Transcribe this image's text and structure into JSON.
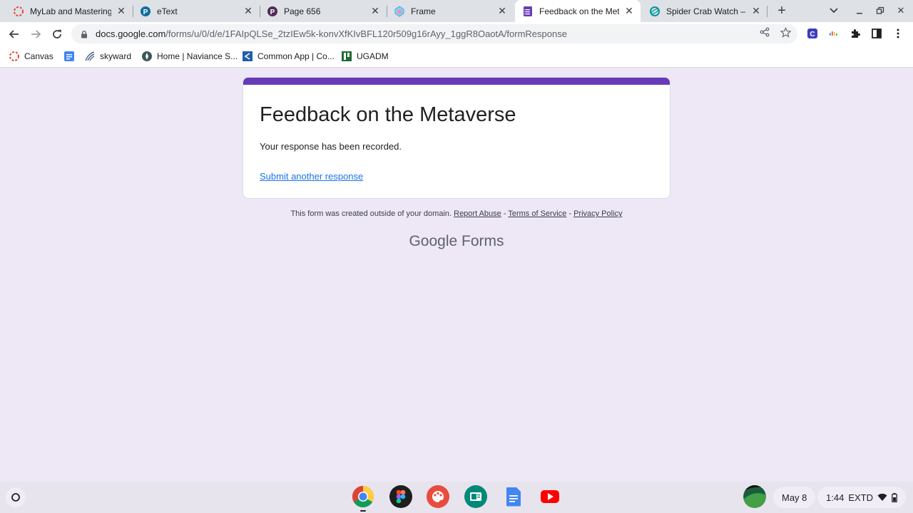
{
  "tabs": [
    {
      "title": "MyLab and Mastering",
      "icon": "mylab-icon"
    },
    {
      "title": "eText",
      "icon": "pearson-icon"
    },
    {
      "title": "Page 656",
      "icon": "pearson-icon"
    },
    {
      "title": "Frame",
      "icon": "frame-icon"
    },
    {
      "title": "Feedback on the Metav",
      "icon": "forms-icon",
      "active": true
    },
    {
      "title": "Spider Crab Watch – Z",
      "icon": "zooniverse-icon"
    }
  ],
  "address": {
    "host": "docs.google.com",
    "path": "/forms/u/0/d/e/1FAIpQLSe_2tzIEw5k-konvXfKIvBFL120r509g16rAyy_1ggR8OaotA/formResponse"
  },
  "bookmarks": [
    {
      "label": "Canvas"
    },
    {
      "label": ""
    },
    {
      "label": "skyward"
    },
    {
      "label": "Home | Naviance S..."
    },
    {
      "label": "Common App | Co..."
    },
    {
      "label": "UGADM"
    }
  ],
  "form": {
    "title": "Feedback on the Metaverse",
    "confirmation": "Your response has been recorded.",
    "another_link": "Submit another response",
    "accent_color": "#673ab7"
  },
  "footer": {
    "note": "This form was created outside of your domain.",
    "report_abuse": "Report Abuse",
    "sep1": " - ",
    "terms": "Terms of Service",
    "sep2": " - ",
    "privacy": "Privacy Policy",
    "brand_google": "Google",
    "brand_forms": "Forms"
  },
  "shelf": {
    "date": "May 8",
    "time": "1:44",
    "extd": "EXTD"
  }
}
